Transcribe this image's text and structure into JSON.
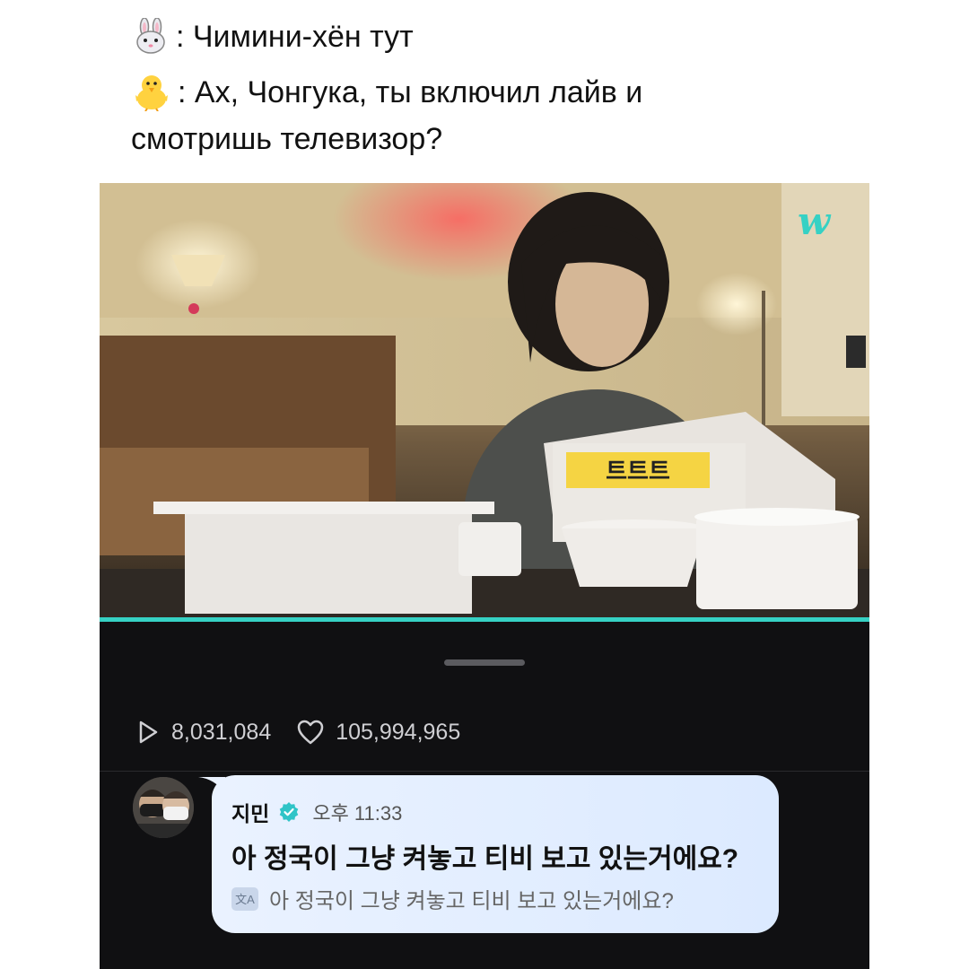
{
  "caption": {
    "line1_speaker_icon": "rabbit-emoji",
    "line1_text": ": Чимини-хён тут",
    "line2_speaker_icon": "chick-emoji",
    "line2_text": ": Ах, Чонгука, ты включил лайв и",
    "line3_text": "смотришь телевизор?"
  },
  "video": {
    "brand_logo_text": "w",
    "accent_color": "#36d1c4"
  },
  "stats": {
    "play_icon": "play-icon",
    "plays": "8,031,084",
    "heart_icon": "heart-icon",
    "likes": "105,994,965"
  },
  "comment": {
    "author": "지민",
    "verified_icon": "verified-badge-icon",
    "time": "오후 11:33",
    "message": "아 정국이 그냥 켜놓고 티비 보고 있는거에요?",
    "translate_icon": "translate-icon",
    "translation": "아 정국이 그냥 켜놓고 티비 보고 있는거에요?"
  }
}
